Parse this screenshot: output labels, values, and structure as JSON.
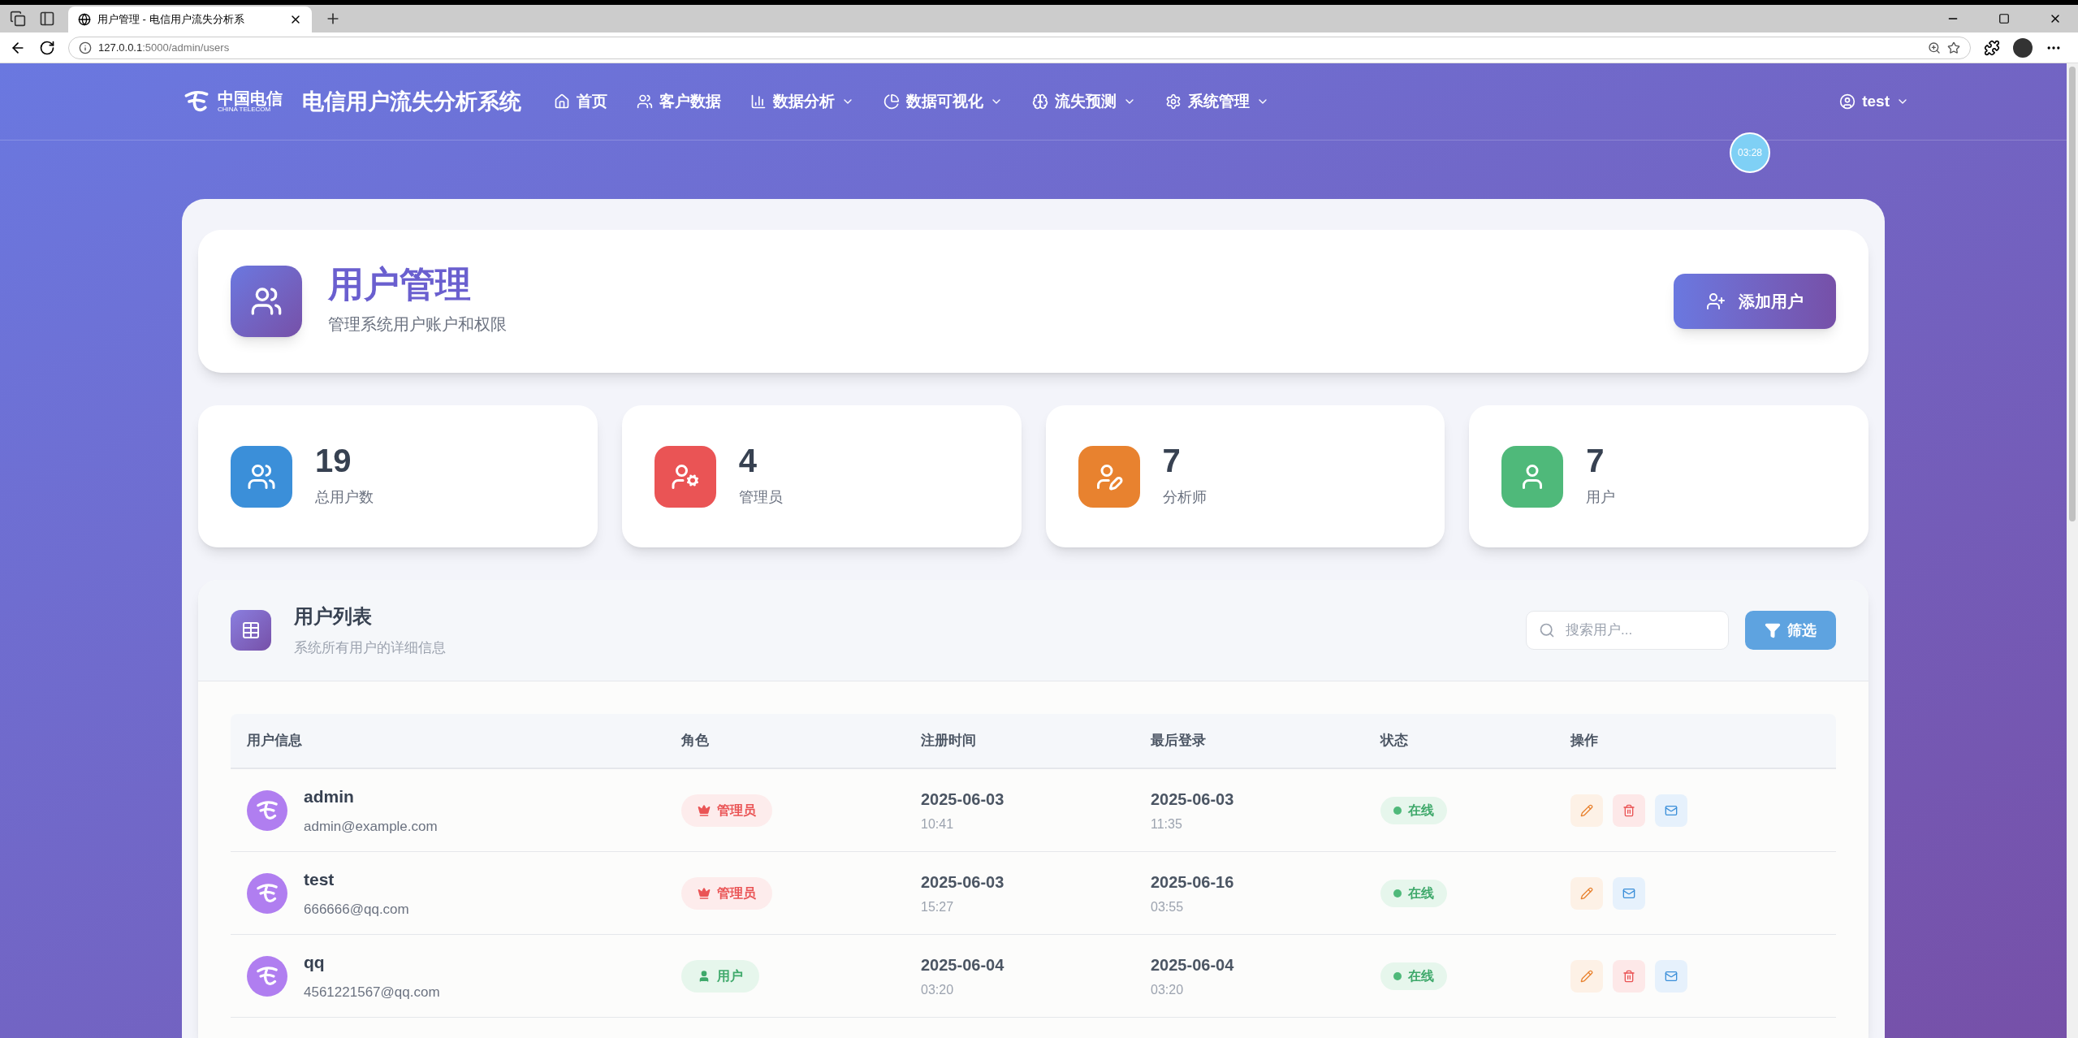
{
  "browser": {
    "tab_title": "用户管理 - 电信用户流失分析系",
    "url_host": "127.0.0.1",
    "url_path": ":5000/admin/users"
  },
  "nav": {
    "logo_cn": "中国电信",
    "logo_en": "CHINA TELECOM",
    "brand": "电信用户流失分析系统",
    "items": [
      {
        "label": "首页",
        "dropdown": false
      },
      {
        "label": "客户数据",
        "dropdown": false
      },
      {
        "label": "数据分析",
        "dropdown": true
      },
      {
        "label": "数据可视化",
        "dropdown": true
      },
      {
        "label": "流失预测",
        "dropdown": true
      },
      {
        "label": "系统管理",
        "dropdown": true
      }
    ],
    "user": "test",
    "timer": "03:28"
  },
  "header": {
    "title": "用户管理",
    "subtitle": "管理系统用户账户和权限",
    "add_button": "添加用户"
  },
  "stats": [
    {
      "value": "19",
      "label": "总用户数",
      "color": "#3b8fd9"
    },
    {
      "value": "4",
      "label": "管理员",
      "color": "#ea5455"
    },
    {
      "value": "7",
      "label": "分析师",
      "color": "#e8822f"
    },
    {
      "value": "7",
      "label": "用户",
      "color": "#4fb97a"
    }
  ],
  "list": {
    "title": "用户列表",
    "subtitle": "系统所有用户的详细信息",
    "search": {
      "placeholder": "搜索用户..."
    },
    "filter_button": "筛选",
    "columns": [
      "用户信息",
      "角色",
      "注册时间",
      "最后登录",
      "状态",
      "操作"
    ],
    "rows": [
      {
        "name": "admin",
        "email": "admin@example.com",
        "role": {
          "text": "管理员",
          "kind": "admin"
        },
        "reg_date": "2025-06-03",
        "reg_time": "10:41",
        "login_date": "2025-06-03",
        "login_time": "11:35",
        "status": "在线",
        "actions": [
          {
            "kind": "edit"
          },
          {
            "kind": "delete"
          },
          {
            "kind": "mail"
          }
        ]
      },
      {
        "name": "test",
        "email": "666666@qq.com",
        "role": {
          "text": "管理员",
          "kind": "admin"
        },
        "reg_date": "2025-06-03",
        "reg_time": "15:27",
        "login_date": "2025-06-16",
        "login_time": "03:55",
        "status": "在线",
        "actions": [
          {
            "kind": "edit"
          },
          {
            "kind": "mail"
          }
        ]
      },
      {
        "name": "qq",
        "email": "4561221567@qq.com",
        "role": {
          "text": "用户",
          "kind": "user"
        },
        "reg_date": "2025-06-04",
        "reg_time": "03:20",
        "login_date": "2025-06-04",
        "login_time": "03:20",
        "status": "在线",
        "actions": [
          {
            "kind": "edit"
          },
          {
            "kind": "delete"
          },
          {
            "kind": "mail"
          }
        ]
      }
    ]
  }
}
